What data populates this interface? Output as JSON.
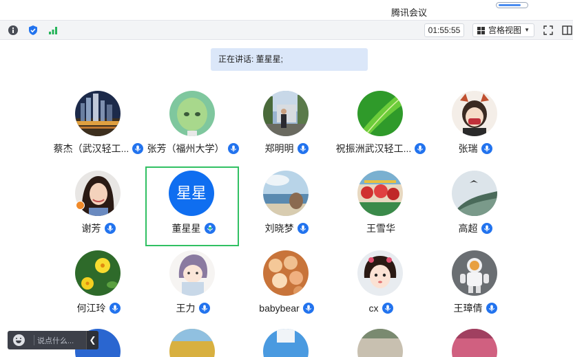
{
  "window": {
    "title": "腾讯会议"
  },
  "toolbar": {
    "info_icon": "info-icon",
    "security_icon": "shield-icon",
    "signal_icon": "signal-bars-icon",
    "timer": "01:55:55",
    "view_label": "宫格视图",
    "fullscreen_icon": "fullscreen-icon",
    "sidebar_icon": "panel-icon"
  },
  "speaking": {
    "text": "正在讲话: 董星星;"
  },
  "participants": [
    {
      "name": "蔡杰（武汉轻工...",
      "avatar": "city-night"
    },
    {
      "name": "张芳（福州大学）",
      "avatar": "green-doll"
    },
    {
      "name": "郑明明",
      "avatar": "person-outdoors"
    },
    {
      "name": "祝振洲武汉轻工...",
      "avatar": "green-leaf"
    },
    {
      "name": "张瑞",
      "avatar": "cartoon-girl"
    },
    {
      "name": "谢芳",
      "avatar": "woman-portrait"
    },
    {
      "name": "董星星",
      "avatar_text": "星星",
      "active": true
    },
    {
      "name": "刘晓梦",
      "avatar": "seaside"
    },
    {
      "name": "王雪华",
      "avatar": "red-decorations"
    },
    {
      "name": "高超",
      "avatar": "bird-sky"
    },
    {
      "name": "何江玲",
      "avatar": "yellow-flowers"
    },
    {
      "name": "王力",
      "avatar": "hooded-cartoon"
    },
    {
      "name": "babybear",
      "avatar": "food-balls"
    },
    {
      "name": "cx",
      "avatar": "child-face"
    },
    {
      "name": "王璋倩",
      "avatar": "astronaut-toy"
    }
  ],
  "chat": {
    "placeholder": "说点什么..."
  },
  "colors": {
    "accent_blue": "#2273ee",
    "active_border": "#30c062",
    "speaking_bg": "#dbe7f9"
  }
}
